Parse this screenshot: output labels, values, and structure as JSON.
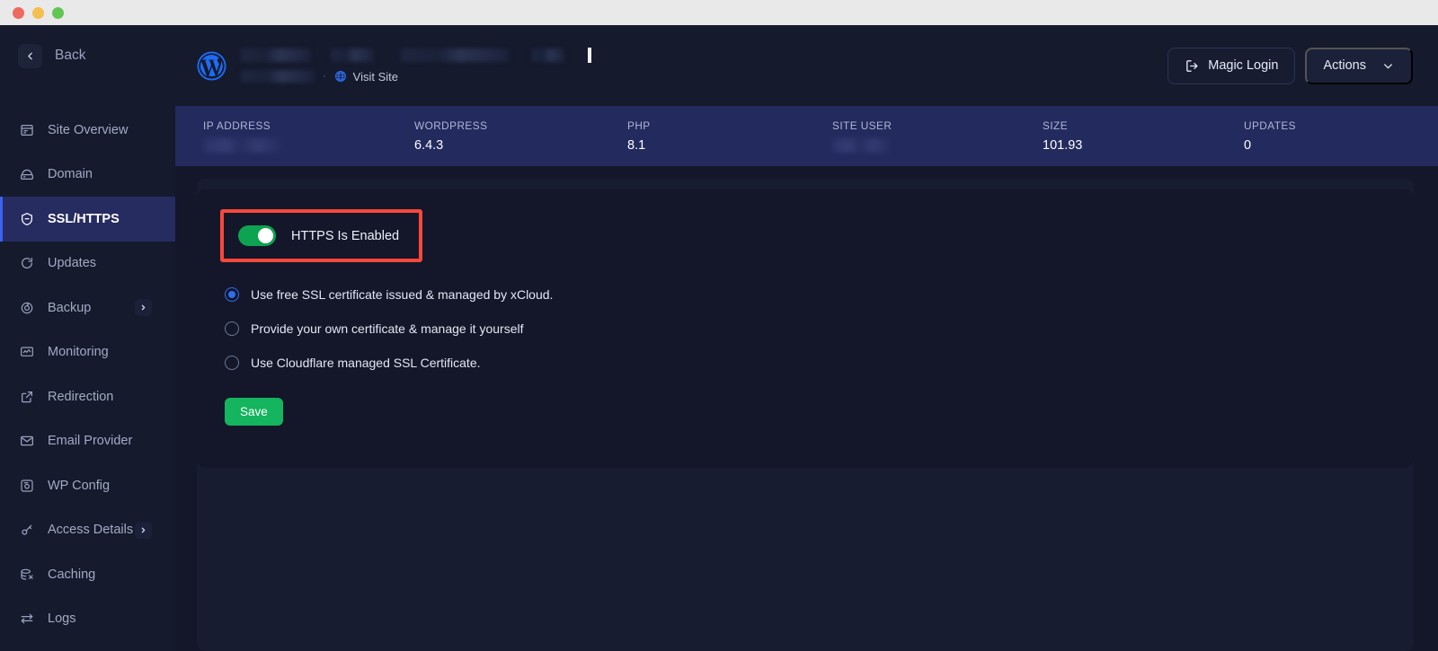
{
  "window": {
    "traffic_lights": [
      "close",
      "minimize",
      "zoom"
    ]
  },
  "sidebar": {
    "back_label": "Back",
    "back_icon": "chevron-left-icon",
    "items": [
      {
        "label": "Site Overview",
        "icon": "site-overview-icon",
        "active": false,
        "has_chevron": false
      },
      {
        "label": "Domain",
        "icon": "domain-icon",
        "active": false,
        "has_chevron": false
      },
      {
        "label": "SSL/HTTPS",
        "icon": "shield-icon",
        "active": true,
        "has_chevron": false
      },
      {
        "label": "Updates",
        "icon": "refresh-icon",
        "active": false,
        "has_chevron": false
      },
      {
        "label": "Backup",
        "icon": "backup-icon",
        "active": false,
        "has_chevron": true
      },
      {
        "label": "Monitoring",
        "icon": "monitoring-icon",
        "active": false,
        "has_chevron": false
      },
      {
        "label": "Redirection",
        "icon": "external-link-icon",
        "active": false,
        "has_chevron": false
      },
      {
        "label": "Email Provider",
        "icon": "envelope-icon",
        "active": false,
        "has_chevron": false
      },
      {
        "label": "WP Config",
        "icon": "wp-config-icon",
        "active": false,
        "has_chevron": false
      },
      {
        "label": "Access Details",
        "icon": "key-icon",
        "active": false,
        "has_chevron": true
      },
      {
        "label": "Caching",
        "icon": "caching-icon",
        "active": false,
        "has_chevron": false
      },
      {
        "label": "Logs",
        "icon": "logs-icon",
        "active": false,
        "has_chevron": false
      }
    ],
    "chevron_icon": "chevron-right-icon"
  },
  "topbar": {
    "logo_icon": "wordpress-logo-icon",
    "site_name": "",
    "site_url": "",
    "visit_site_label": "Visit Site",
    "visit_site_icon": "globe-icon",
    "magic_login_label": "Magic Login",
    "magic_login_icon": "login-arrow-icon",
    "actions_label": "Actions",
    "actions_icon": "chevron-down-icon"
  },
  "infobar": {
    "cells": [
      {
        "label": "IP ADDRESS",
        "value": "",
        "redacted": true
      },
      {
        "label": "WORDPRESS",
        "value": "6.4.3",
        "redacted": false
      },
      {
        "label": "PHP",
        "value": "8.1",
        "redacted": false
      },
      {
        "label": "SITE USER",
        "value": "",
        "redacted": true
      },
      {
        "label": "SIZE",
        "value": "101.93",
        "redacted": false
      },
      {
        "label": "UPDATES",
        "value": "0",
        "redacted": false
      }
    ]
  },
  "ssl_panel": {
    "toggle": {
      "label": "HTTPS Is Enabled",
      "enabled": true,
      "highlight_color": "#f9473b",
      "on_color": "#0ea350"
    },
    "options": [
      {
        "label": "Use free SSL certificate issued & managed by xCloud.",
        "selected": true
      },
      {
        "label": "Provide your own certificate & manage it yourself",
        "selected": false
      },
      {
        "label": "Use Cloudflare managed SSL Certificate.",
        "selected": false
      }
    ],
    "save_label": "Save",
    "save_color": "#15b45f"
  },
  "colors": {
    "app_bg": "#131729",
    "sidebar_bg": "#151a2d",
    "active_nav": "#262b60",
    "infobar_bg": "#232a5e",
    "accent_blue": "#2f6ef0",
    "wp_blue": "#1e6bf5"
  }
}
